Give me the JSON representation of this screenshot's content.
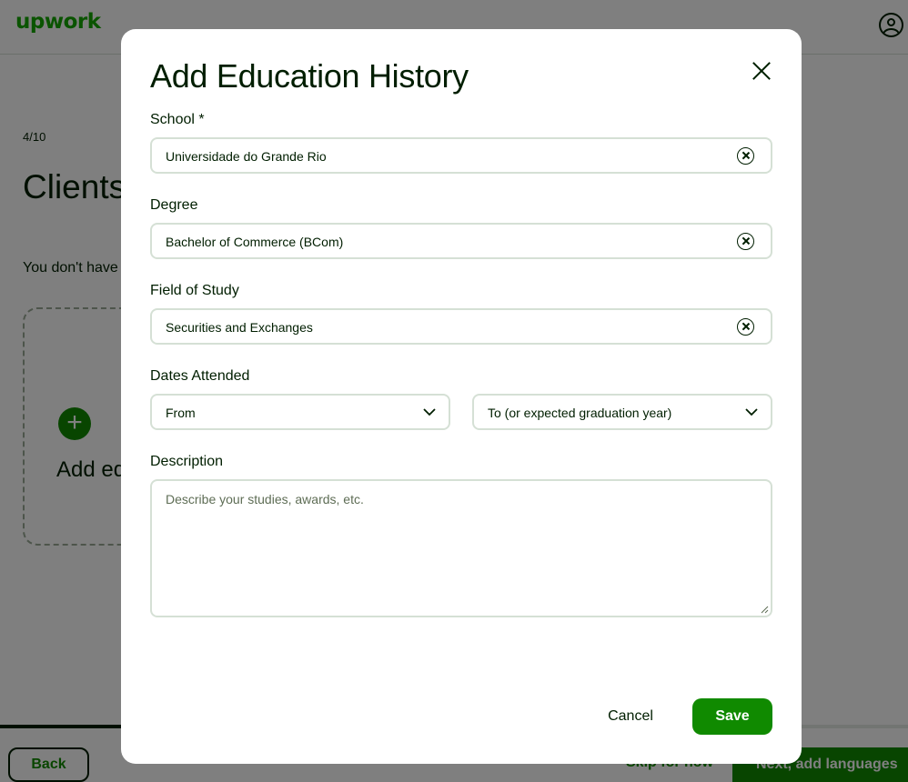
{
  "background": {
    "logo": "upwork",
    "step": "4/10",
    "title": "Clients like to know what you know - add your education here.",
    "subtitle": "You don't have to have a degree.",
    "add_card_label": "Add education",
    "progress": 0.4,
    "back_label": "Back",
    "skip_label": "Skip for now",
    "next_label": "Next, add languages"
  },
  "modal": {
    "title": "Add Education History",
    "school": {
      "label": "School *",
      "value": "Universidade do Grande Rio"
    },
    "degree": {
      "label": "Degree",
      "value": "Bachelor of Commerce (BCom)"
    },
    "field_of_study": {
      "label": "Field of Study",
      "value": "Securities and Exchanges"
    },
    "dates": {
      "label": "Dates Attended",
      "from": "From",
      "to": "To (or expected graduation year)"
    },
    "description": {
      "label": "Description",
      "placeholder": "Describe your studies, awards, etc."
    },
    "cancel_label": "Cancel",
    "save_label": "Save"
  },
  "colors": {
    "brand_green": "#108a00",
    "logo_green": "#14a800",
    "text": "#001e00",
    "border": "#d5e0d5"
  }
}
